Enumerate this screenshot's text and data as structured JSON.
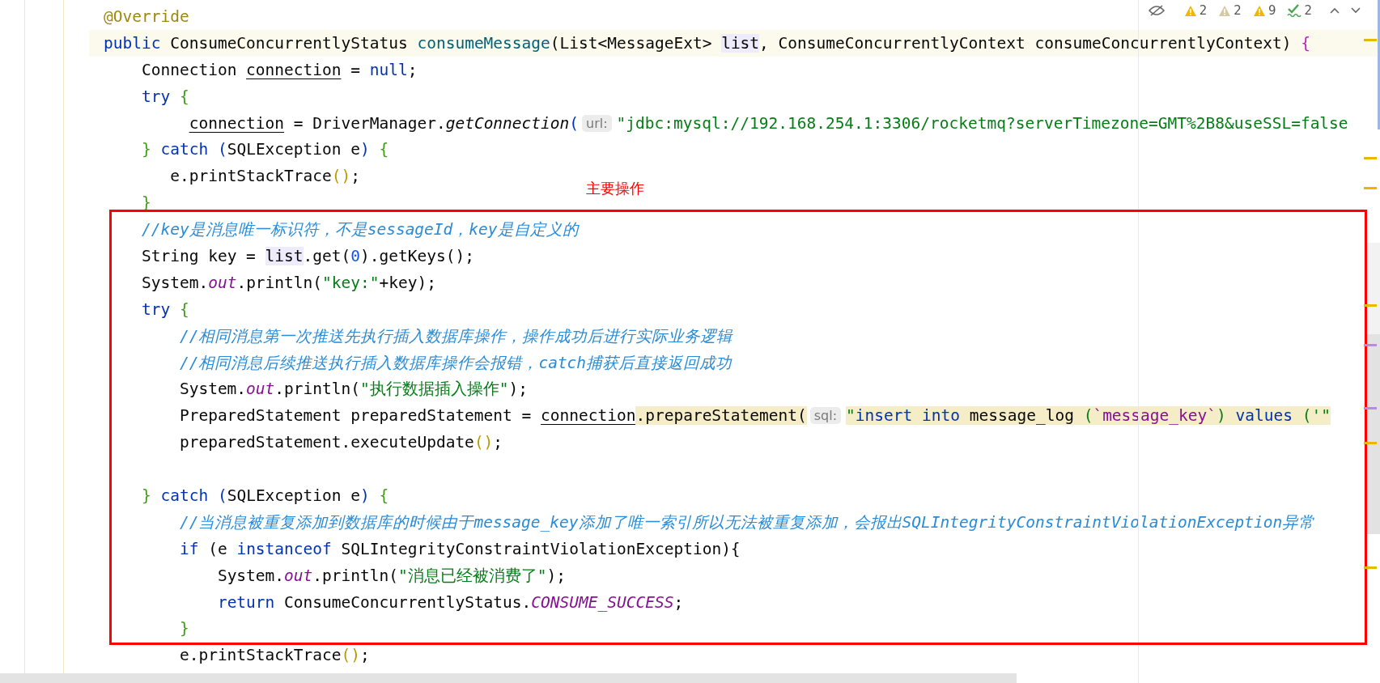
{
  "inspections": [
    {
      "kind": "warning",
      "count": "2",
      "color": "#f2b600"
    },
    {
      "kind": "weak",
      "count": "2",
      "color": "#d4c9a6"
    },
    {
      "kind": "warning",
      "count": "9",
      "color": "#f2b600"
    },
    {
      "kind": "typo",
      "count": "2",
      "color": "#4aa552"
    }
  ],
  "annotation": {
    "label": "主要操作"
  },
  "lines": [
    {
      "current": false,
      "tokens": [
        {
          "text": "@Override",
          "kind": "annotation"
        }
      ]
    },
    {
      "current": true,
      "tokens": [
        {
          "text": "public ",
          "kind": "keyword"
        },
        {
          "text": "ConsumeConcurrentlyStatus ",
          "kind": "plain"
        },
        {
          "text": "consumeMessage",
          "kind": "decl"
        },
        {
          "text": "(List<MessageExt> ",
          "kind": "plain"
        },
        {
          "text": "list",
          "kind": "hl"
        },
        {
          "text": ", ConsumeConcurrentlyContext consumeConcurrentlyContext) ",
          "kind": "plain"
        },
        {
          "text": "{",
          "kind": "outer"
        }
      ]
    },
    {
      "current": false,
      "tokens": [
        {
          "text": "    Connection ",
          "kind": "plain"
        },
        {
          "text": "connection",
          "kind": "reassigned"
        },
        {
          "text": " = ",
          "kind": "plain"
        },
        {
          "text": "null",
          "kind": "keyword"
        },
        {
          "text": ";",
          "kind": "plain"
        }
      ]
    },
    {
      "current": false,
      "tokens": [
        {
          "text": "    try ",
          "kind": "keyword"
        },
        {
          "text": "{",
          "kind": "brace"
        }
      ]
    },
    {
      "current": false,
      "tokens": [
        {
          "text": "         connection",
          "kind": "reassigned"
        },
        {
          "text": " = DriverManager.",
          "kind": "plain"
        },
        {
          "text": "getConnection",
          "kind": "static"
        },
        {
          "text": "(",
          "kind": "paren"
        },
        {
          "text": "url:",
          "kind": "hint"
        },
        {
          "text": "\"jdbc:mysql://192.168.254.1:3306/rocketmq?serverTimezone=GMT%2B8&useSSL=false",
          "kind": "string"
        }
      ]
    },
    {
      "current": false,
      "tokens": [
        {
          "text": "    } ",
          "kind": "brace"
        },
        {
          "text": "catch ",
          "kind": "keyword"
        },
        {
          "text": "(",
          "kind": "paren"
        },
        {
          "text": "SQLException e",
          "kind": "plain"
        },
        {
          "text": ") ",
          "kind": "paren"
        },
        {
          "text": "{",
          "kind": "brace"
        }
      ]
    },
    {
      "current": false,
      "tokens": [
        {
          "text": "       e.printStackTrace",
          "kind": "plain"
        },
        {
          "text": "()",
          "kind": "call"
        },
        {
          "text": ";",
          "kind": "plain"
        }
      ]
    },
    {
      "current": false,
      "tokens": [
        {
          "text": "    }",
          "kind": "brace"
        }
      ]
    },
    {
      "current": false,
      "tokens": [
        {
          "text": "    //key是消息唯一标识符，不是sessageId，key是自定义的",
          "kind": "comment"
        }
      ]
    },
    {
      "current": false,
      "tokens": [
        {
          "text": "    String key = ",
          "kind": "plain"
        },
        {
          "text": "list",
          "kind": "hl"
        },
        {
          "text": ".get(",
          "kind": "plain"
        },
        {
          "text": "0",
          "kind": "number"
        },
        {
          "text": ").getKeys();",
          "kind": "plain"
        }
      ]
    },
    {
      "current": false,
      "tokens": [
        {
          "text": "    System.",
          "kind": "plain"
        },
        {
          "text": "out",
          "kind": "field"
        },
        {
          "text": ".println(",
          "kind": "plain"
        },
        {
          "text": "\"key:\"",
          "kind": "string"
        },
        {
          "text": "+key);",
          "kind": "plain"
        }
      ]
    },
    {
      "current": false,
      "tokens": [
        {
          "text": "    try ",
          "kind": "keyword"
        },
        {
          "text": "{",
          "kind": "brace"
        }
      ]
    },
    {
      "current": false,
      "tokens": [
        {
          "text": "        //相同消息第一次推送先执行插入数据库操作，操作成功后进行实际业务逻辑",
          "kind": "comment"
        }
      ]
    },
    {
      "current": false,
      "tokens": [
        {
          "text": "        //相同消息后续推送执行插入数据库操作会报错，catch捕获后直接返回成功",
          "kind": "comment"
        }
      ]
    },
    {
      "current": false,
      "tokens": [
        {
          "text": "        System.",
          "kind": "plain"
        },
        {
          "text": "out",
          "kind": "field"
        },
        {
          "text": ".println(",
          "kind": "plain"
        },
        {
          "text": "\"执行数据插入操作\"",
          "kind": "string"
        },
        {
          "text": ");",
          "kind": "plain"
        }
      ]
    },
    {
      "current": false,
      "tokens": [
        {
          "text": "        PreparedStatement preparedStatement = ",
          "kind": "plain"
        },
        {
          "text": "connection",
          "kind": "reassigned"
        },
        {
          "text": ".prepareStatement(",
          "kind": "marked"
        },
        {
          "text": "sql:",
          "kind": "hint"
        },
        {
          "text": "\"",
          "kind": "sqlstr"
        },
        {
          "text": "insert into ",
          "kind": "sqlkw"
        },
        {
          "text": "message_log ",
          "kind": "sqlplain"
        },
        {
          "text": "(",
          "kind": "sqlstr"
        },
        {
          "text": "`message_key`",
          "kind": "sqlcol"
        },
        {
          "text": ") ",
          "kind": "sqlstr"
        },
        {
          "text": "values ",
          "kind": "sqlkw"
        },
        {
          "text": "('\"",
          "kind": "sqlstr"
        }
      ]
    },
    {
      "current": false,
      "tokens": [
        {
          "text": "        preparedStatement.executeUpdate",
          "kind": "plain"
        },
        {
          "text": "()",
          "kind": "call"
        },
        {
          "text": ";",
          "kind": "plain"
        }
      ]
    },
    {
      "current": false
    },
    {
      "current": false,
      "tokens": [
        {
          "text": "    } ",
          "kind": "brace"
        },
        {
          "text": "catch ",
          "kind": "keyword"
        },
        {
          "text": "(",
          "kind": "paren"
        },
        {
          "text": "SQLException e",
          "kind": "plain"
        },
        {
          "text": ") ",
          "kind": "paren"
        },
        {
          "text": "{",
          "kind": "brace"
        }
      ]
    },
    {
      "current": false,
      "tokens": [
        {
          "text": "        //当消息被重复添加到数据库的时候由于message_key添加了唯一索引所以无法被重复添加，会报出SQLIntegrityConstraintViolationException异常",
          "kind": "comment"
        }
      ]
    },
    {
      "current": false,
      "tokens": [
        {
          "text": "        if ",
          "kind": "keyword"
        },
        {
          "text": "(e ",
          "kind": "plain"
        },
        {
          "text": "instanceof ",
          "kind": "keyword"
        },
        {
          "text": "SQLIntegrityConstraintViolationException){",
          "kind": "plain"
        }
      ]
    },
    {
      "current": false,
      "tokens": [
        {
          "text": "            System.",
          "kind": "plain"
        },
        {
          "text": "out",
          "kind": "field"
        },
        {
          "text": ".println(",
          "kind": "plain"
        },
        {
          "text": "\"消息已经被消费了\"",
          "kind": "string"
        },
        {
          "text": ");",
          "kind": "plain"
        }
      ]
    },
    {
      "current": false,
      "tokens": [
        {
          "text": "            return ",
          "kind": "keyword"
        },
        {
          "text": "ConsumeConcurrentlyStatus.",
          "kind": "plain"
        },
        {
          "text": "CONSUME_SUCCESS",
          "kind": "field"
        },
        {
          "text": ";",
          "kind": "plain"
        }
      ]
    },
    {
      "current": false,
      "tokens": [
        {
          "text": "        }",
          "kind": "brace"
        }
      ]
    },
    {
      "current": false,
      "tokens": [
        {
          "text": "        e.printStackTrace",
          "kind": "plain"
        },
        {
          "text": "()",
          "kind": "call"
        },
        {
          "text": ";",
          "kind": "plain"
        }
      ]
    }
  ]
}
